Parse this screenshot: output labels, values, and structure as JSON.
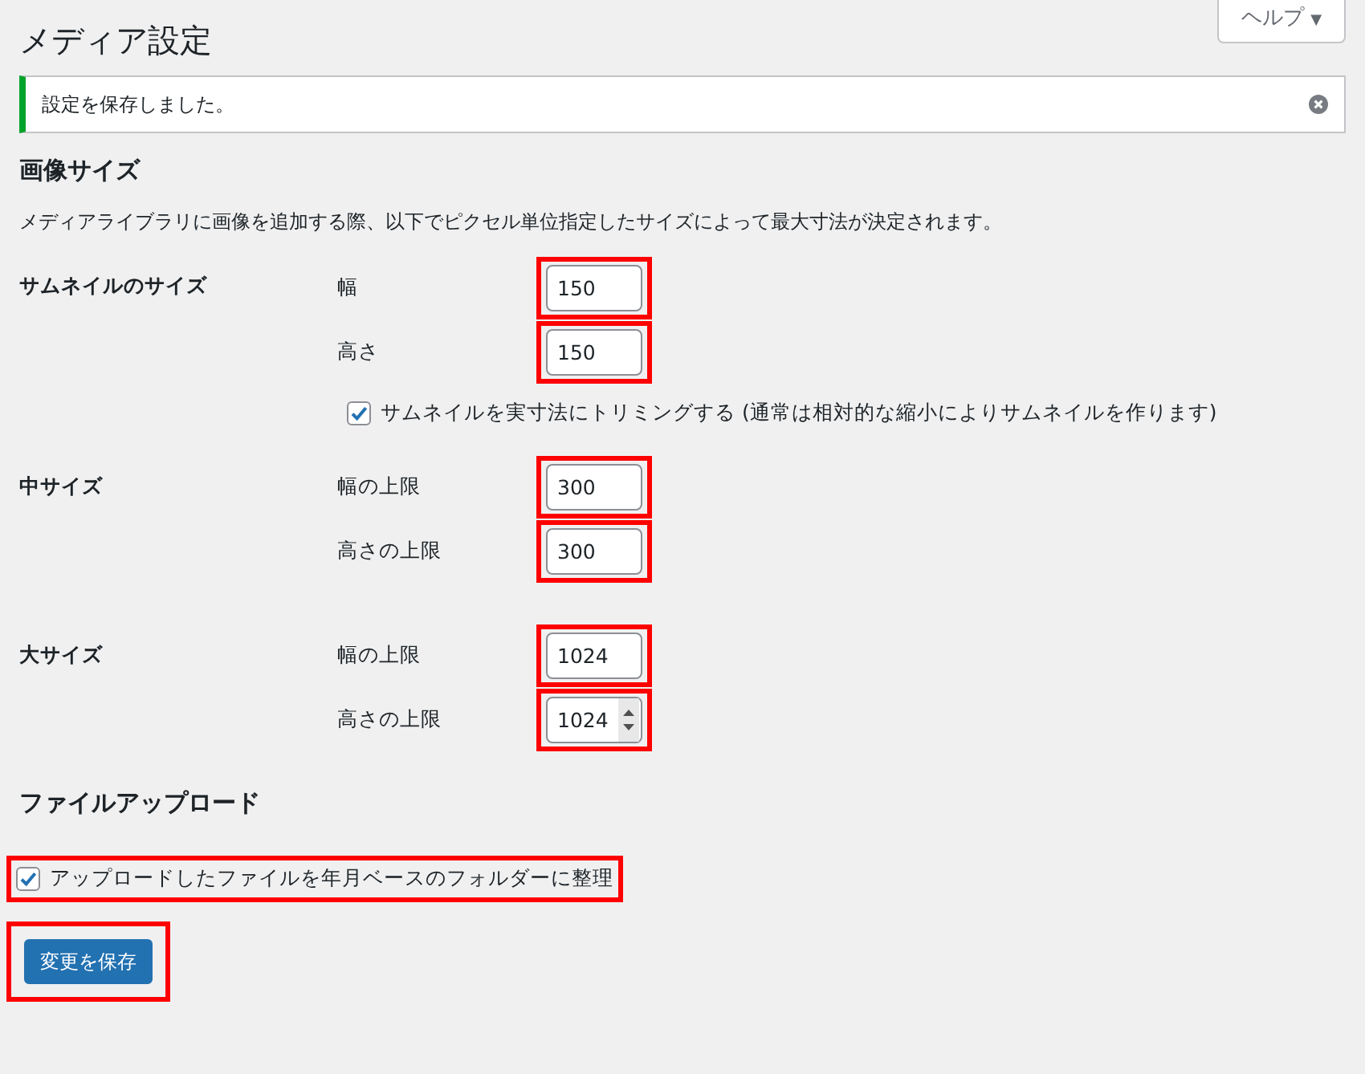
{
  "help_button": {
    "label": "ヘルプ",
    "caret": "▼"
  },
  "page_title": "メディア設定",
  "notice": {
    "text": "設定を保存しました。"
  },
  "image_sizes": {
    "heading": "画像サイズ",
    "description": "メディアライブラリに画像を追加する際、以下でピクセル単位指定したサイズによって最大寸法が決定されます。",
    "groups": [
      {
        "label": "サムネイルのサイズ",
        "fields": [
          {
            "label": "幅",
            "value": "150",
            "highlighted": true,
            "spinner": false
          },
          {
            "label": "高さ",
            "value": "150",
            "highlighted": true,
            "spinner": false
          }
        ],
        "option": {
          "label": "サムネイルを実寸法にトリミングする (通常は相対的な縮小によりサムネイルを作ります)",
          "checked": true,
          "highlighted": false
        }
      },
      {
        "label": "中サイズ",
        "fields": [
          {
            "label": "幅の上限",
            "value": "300",
            "highlighted": true,
            "spinner": false
          },
          {
            "label": "高さの上限",
            "value": "300",
            "highlighted": true,
            "spinner": false
          }
        ]
      },
      {
        "label": "大サイズ",
        "fields": [
          {
            "label": "幅の上限",
            "value": "1024",
            "highlighted": true,
            "spinner": false
          },
          {
            "label": "高さの上限",
            "value": "1024",
            "highlighted": true,
            "spinner": true
          }
        ]
      }
    ]
  },
  "uploads": {
    "heading": "ファイルアップロード",
    "option": {
      "label": "アップロードしたファイルを年月ベースのフォルダーに整理",
      "checked": true,
      "highlighted": true
    }
  },
  "save_button": {
    "label": "変更を保存",
    "highlighted": true
  }
}
